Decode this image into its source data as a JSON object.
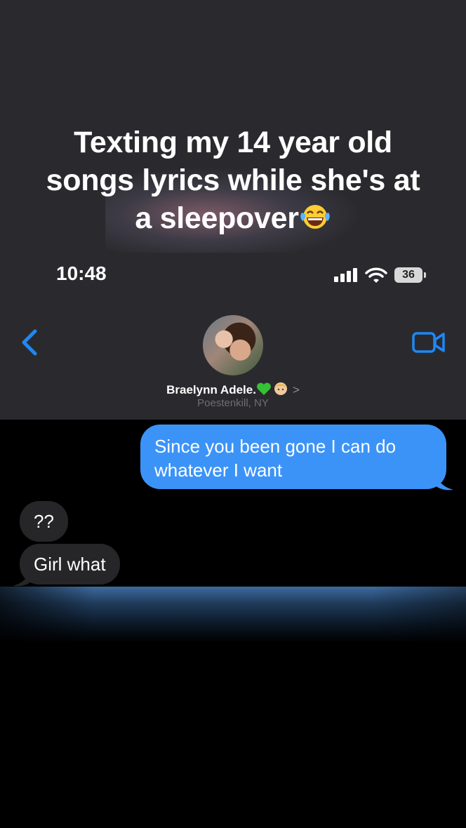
{
  "caption": {
    "line1": "Texting my 14 year old",
    "line2": "songs lyrics while she's at",
    "line3": "a sleepover",
    "emoji": "face-with-tears-of-joy"
  },
  "status_bar": {
    "time": "10:48",
    "battery": "36",
    "icons": [
      "cellular-signal-icon",
      "wifi-icon",
      "battery-icon"
    ]
  },
  "header": {
    "back_icon": "chevron-left-icon",
    "video_icon": "video-camera-icon",
    "contact_name": "Braelynn Adele.",
    "name_emojis": [
      "green-heart",
      "baby-face"
    ],
    "chevron": ">",
    "location": "Poestenkill, NY"
  },
  "messages": [
    {
      "direction": "sent",
      "text": "Since you been gone I can do whatever I want"
    },
    {
      "direction": "received",
      "text": "??"
    },
    {
      "direction": "received",
      "text": "Girl what"
    }
  ],
  "colors": {
    "header_bg": "#2a2a2e",
    "sent_bubble": "#3b93f7",
    "received_bubble": "#262628",
    "accent": "#0a84ff"
  }
}
